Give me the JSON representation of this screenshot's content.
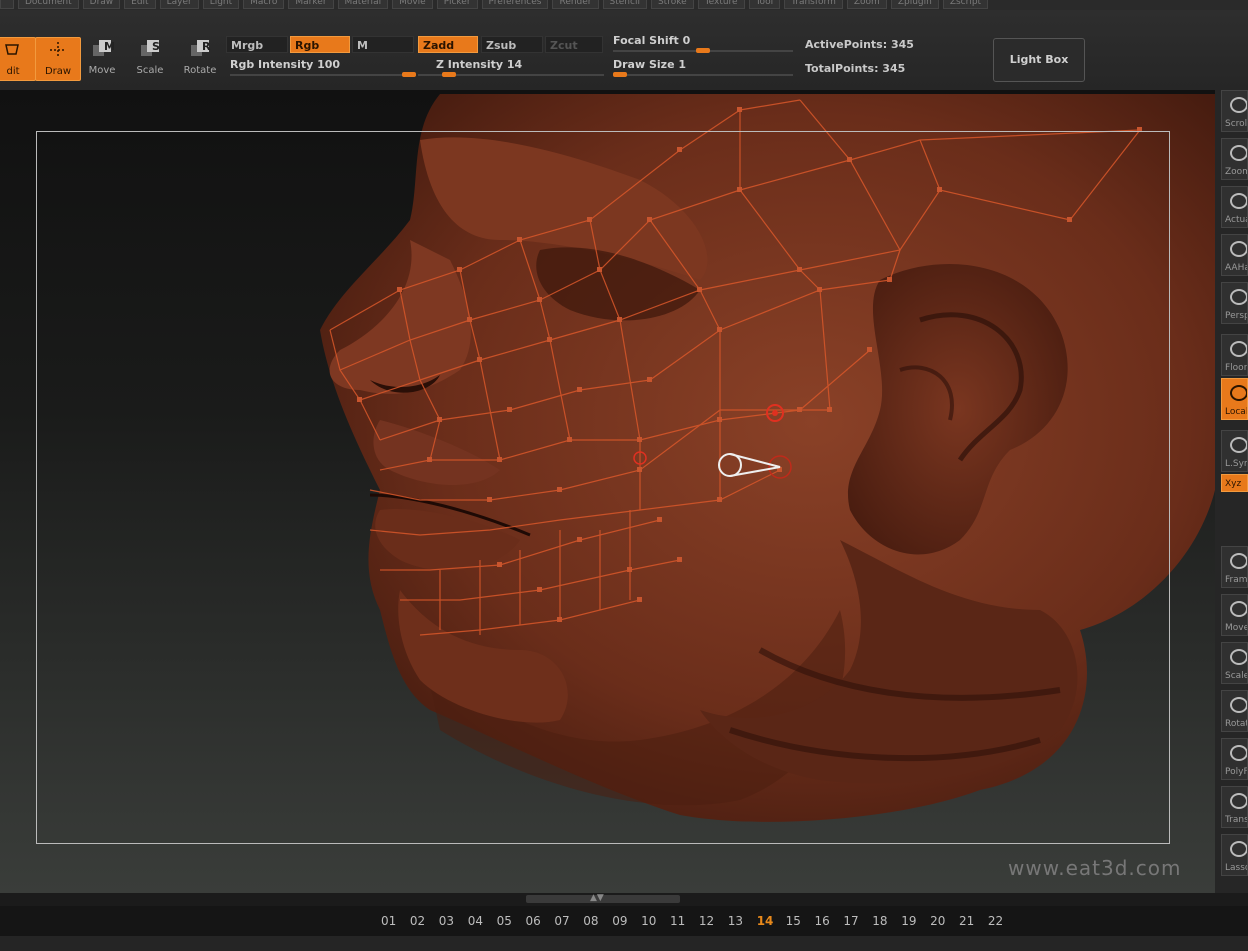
{
  "menu": [
    "",
    "Document",
    "Draw",
    "Edit",
    "Layer",
    "Light",
    "Macro",
    "Marker",
    "Material",
    "Movie",
    "Picker",
    "Preferences",
    "Render",
    "Stencil",
    "Stroke",
    "Texture",
    "Tool",
    "Transform",
    "Zoom",
    "Zplugin",
    "Zscript"
  ],
  "toolbar": {
    "edit_label": "dit",
    "draw_label": "Draw",
    "move_label": "Move",
    "scale_label": "Scale",
    "rotate_label": "Rotate",
    "move_key": "M",
    "scale_key": "S",
    "rotate_key": "R",
    "mrgb": "Mrgb",
    "rgb": "Rgb",
    "m": "M",
    "zadd": "Zadd",
    "zsub": "Zsub",
    "zcut": "Zcut",
    "rgb_intensity": "Rgb Intensity 100",
    "rgb_intensity_level": 1.0,
    "z_intensity": "Z Intensity 14",
    "z_intensity_level": 0.14,
    "focal_shift": "Focal Shift 0",
    "focal_shift_level": 0.5,
    "draw_size": "Draw Size 1",
    "draw_size_level": 0.0,
    "active_points": "ActivePoints: 345",
    "total_points": "TotalPoints: 345",
    "light_box": "Light Box"
  },
  "right_shelf": [
    {
      "label": "Scroll",
      "icon": "hand-icon",
      "on": false
    },
    {
      "label": "Zoom",
      "icon": "magnifier-icon",
      "on": false
    },
    {
      "label": "Actual",
      "icon": "magnifier-icon",
      "on": false
    },
    {
      "label": "AAHalf",
      "icon": "magnifier-icon",
      "on": false
    },
    {
      "label": "Persp",
      "icon": "grid-icon",
      "on": false
    },
    {
      "label": "Floor",
      "icon": "floor-icon",
      "on": false
    },
    {
      "label": "Local",
      "icon": "local-icon",
      "on": true
    },
    {
      "label": "L.Sym",
      "icon": "symmetry-icon",
      "on": false
    },
    {
      "label": "Xyz",
      "icon": "axis-icon",
      "on": true
    },
    {
      "label": "Frame",
      "icon": "frame-icon",
      "on": false
    },
    {
      "label": "Move",
      "icon": "hand-icon",
      "on": false
    },
    {
      "label": "Scale",
      "icon": "magnifier-icon",
      "on": false
    },
    {
      "label": "Rotate",
      "icon": "rotate-icon",
      "on": false
    },
    {
      "label": "PolyF",
      "icon": "grid-icon",
      "on": false
    },
    {
      "label": "Transp",
      "icon": "transp-icon",
      "on": false
    },
    {
      "label": "Lasso",
      "icon": "lasso-icon",
      "on": false
    }
  ],
  "watermark": "www.eat3d.com",
  "timeline": {
    "frames": [
      "01",
      "02",
      "03",
      "04",
      "05",
      "06",
      "07",
      "08",
      "09",
      "10",
      "11",
      "12",
      "13",
      "14",
      "15",
      "16",
      "17",
      "18",
      "19",
      "20",
      "21",
      "22"
    ],
    "current": "14"
  },
  "colors": {
    "accent": "#e8791b",
    "clay": "#6b2f1c",
    "wire": "#d8572a"
  }
}
